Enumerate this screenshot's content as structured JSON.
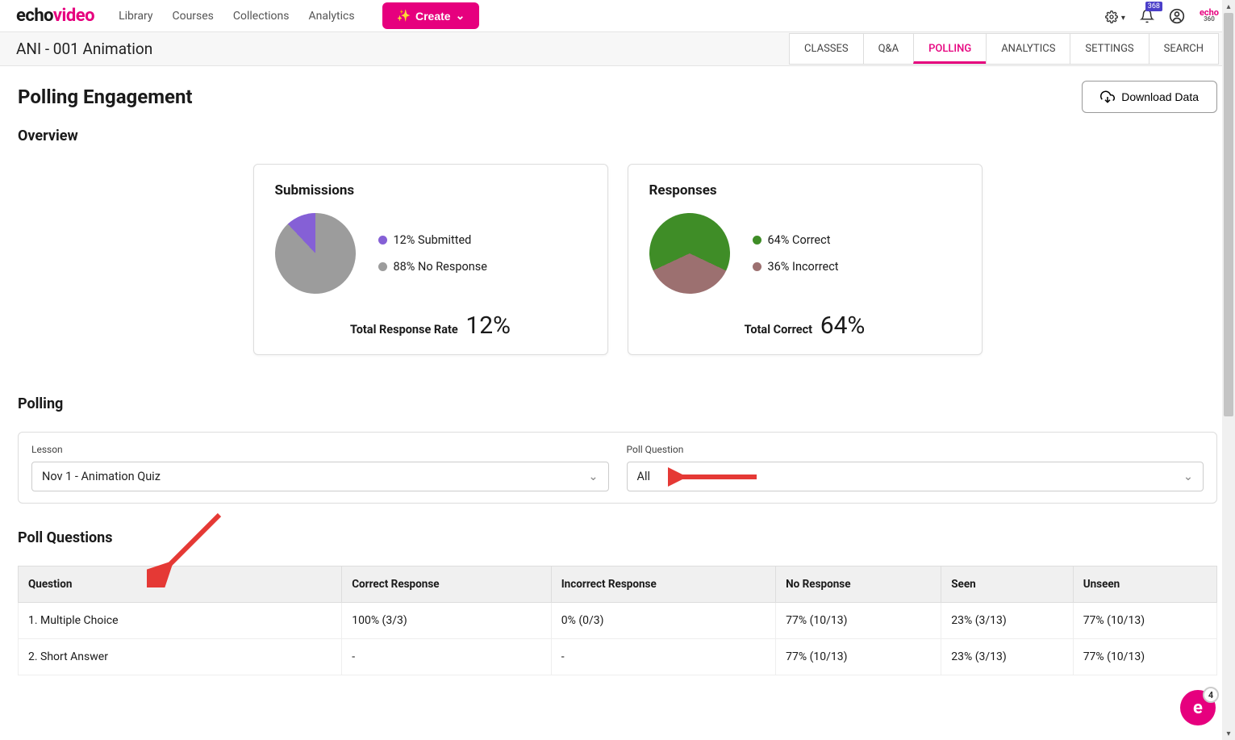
{
  "brand": {
    "part1": "echo",
    "part2": "video",
    "mini_top": "echo",
    "mini_bot": "360"
  },
  "nav": {
    "library": "Library",
    "courses": "Courses",
    "collections": "Collections",
    "analytics": "Analytics"
  },
  "create_label": "Create",
  "notification_count": "368",
  "course_title": "ANI - 001 Animation",
  "tabs": {
    "classes": "CLASSES",
    "qa": "Q&A",
    "polling": "POLLING",
    "analytics": "ANALYTICS",
    "settings": "SETTINGS",
    "search": "SEARCH"
  },
  "page_title": "Polling Engagement",
  "download_label": "Download Data",
  "overview_title": "Overview",
  "chart_data": [
    {
      "type": "pie",
      "title": "Submissions",
      "series": [
        {
          "name": "Submitted",
          "value": 12,
          "color": "#8560d6"
        },
        {
          "name": "No Response",
          "value": 88,
          "color": "#9c9c9c"
        }
      ],
      "legend": [
        {
          "label": "12% Submitted",
          "color": "#8560d6"
        },
        {
          "label": "88% No Response",
          "color": "#9c9c9c"
        }
      ],
      "total_label": "Total Response Rate",
      "total_value": "12%"
    },
    {
      "type": "pie",
      "title": "Responses",
      "series": [
        {
          "name": "Correct",
          "value": 64,
          "color": "#3f8d27"
        },
        {
          "name": "Incorrect",
          "value": 36,
          "color": "#9c7070"
        }
      ],
      "legend": [
        {
          "label": "64% Correct",
          "color": "#3f8d27"
        },
        {
          "label": "36% Incorrect",
          "color": "#9c7070"
        }
      ],
      "total_label": "Total Correct",
      "total_value": "64%"
    }
  ],
  "polling_title": "Polling",
  "filter_lesson_label": "Lesson",
  "filter_lesson_value": "Nov 1 - Animation Quiz",
  "filter_question_label": "Poll Question",
  "filter_question_value": "All",
  "poll_questions_title": "Poll Questions",
  "table": {
    "headers": {
      "q": "Question",
      "correct": "Correct Response",
      "incorrect": "Incorrect Response",
      "noresp": "No Response",
      "seen": "Seen",
      "unseen": "Unseen"
    },
    "rows": [
      {
        "q": "1. Multiple Choice",
        "correct": "100% (3/3)",
        "incorrect": "0% (0/3)",
        "noresp": "77% (10/13)",
        "seen": "23% (3/13)",
        "unseen": "77% (10/13)"
      },
      {
        "q": "2. Short Answer",
        "correct": "-",
        "incorrect": "-",
        "noresp": "77% (10/13)",
        "seen": "23% (3/13)",
        "unseen": "77% (10/13)"
      }
    ]
  },
  "help_count": "4"
}
